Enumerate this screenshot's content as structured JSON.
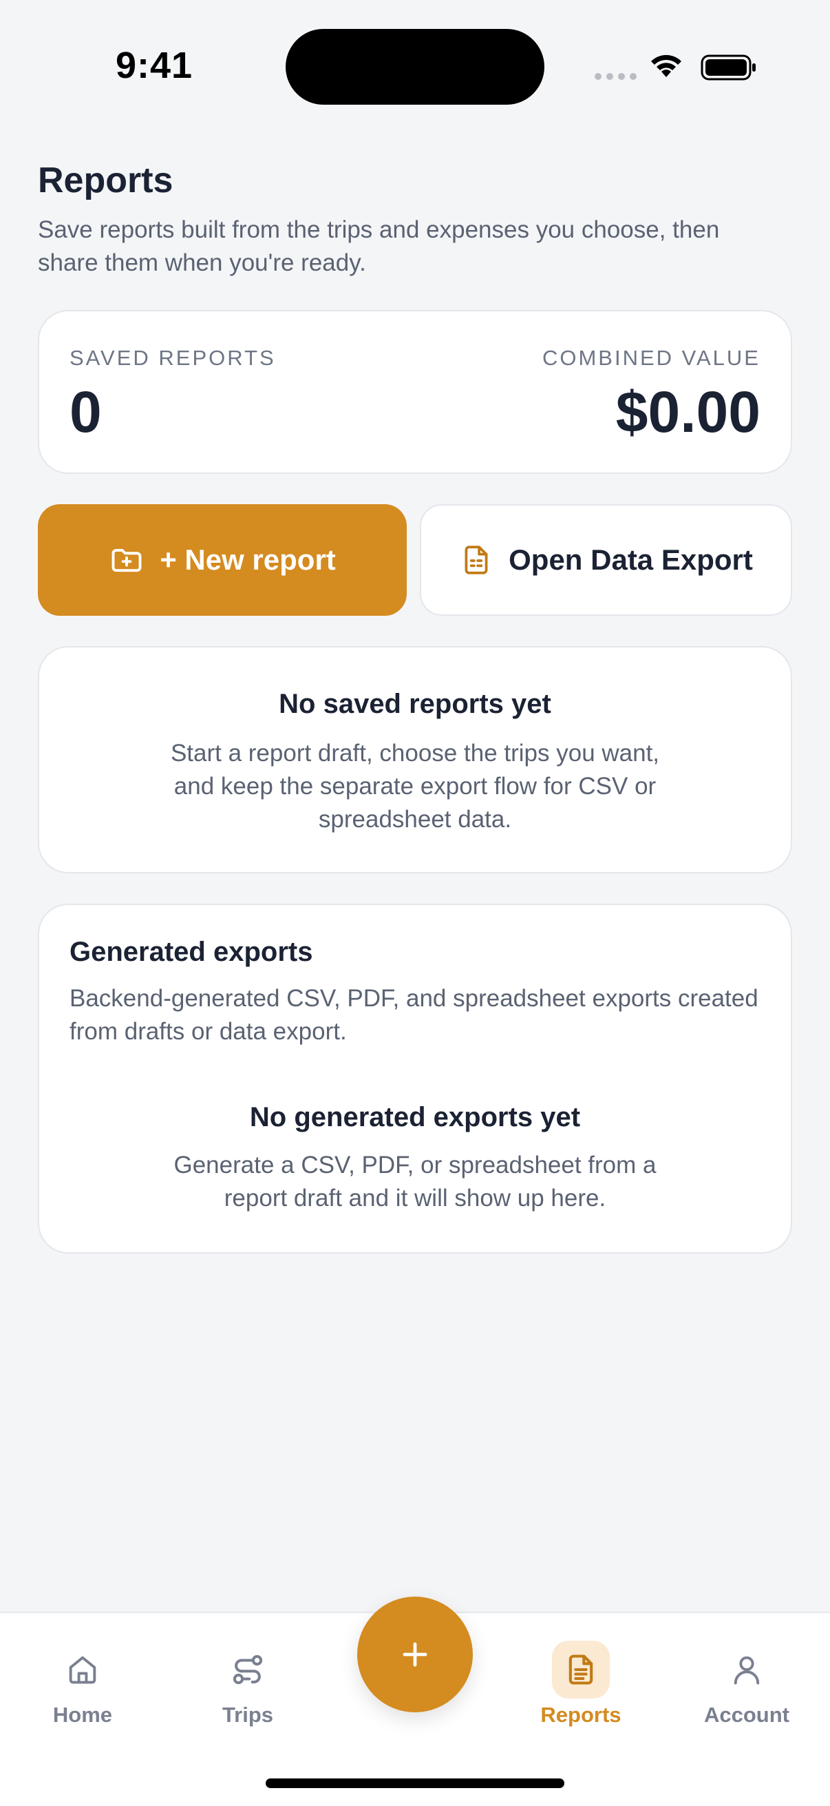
{
  "status_bar": {
    "time": "9:41"
  },
  "header": {
    "title": "Reports",
    "subtitle": "Save reports built from the trips and expenses you choose, then share them when you're ready."
  },
  "summary": {
    "saved_label": "SAVED REPORTS",
    "saved_value": "0",
    "combined_label": "COMBINED VALUE",
    "combined_value": "$0.00"
  },
  "actions": {
    "new_report_label": "+ New report",
    "open_export_label": "Open Data Export"
  },
  "empty_reports": {
    "title": "No saved reports yet",
    "text": "Start a report draft, choose the trips you want, and keep the separate export flow for CSV or spreadsheet data."
  },
  "generated_exports": {
    "title": "Generated exports",
    "description": "Backend-generated CSV, PDF, and spreadsheet exports created from drafts or data export.",
    "empty_title": "No generated exports yet",
    "empty_text": "Generate a CSV, PDF, or spreadsheet from a report draft and it will show up here."
  },
  "tab_bar": {
    "items": [
      {
        "label": "Home",
        "icon": "home-icon"
      },
      {
        "label": "Trips",
        "icon": "route-icon"
      },
      {
        "label": "Reports",
        "icon": "document-icon",
        "active": true
      },
      {
        "label": "Account",
        "icon": "user-icon"
      }
    ],
    "fab_icon": "plus-icon"
  },
  "colors": {
    "accent": "#d48b1f",
    "accent_soft": "#fbe9d2",
    "background": "#f4f5f7",
    "text_primary": "#1b2233",
    "text_secondary": "#5a6272"
  }
}
